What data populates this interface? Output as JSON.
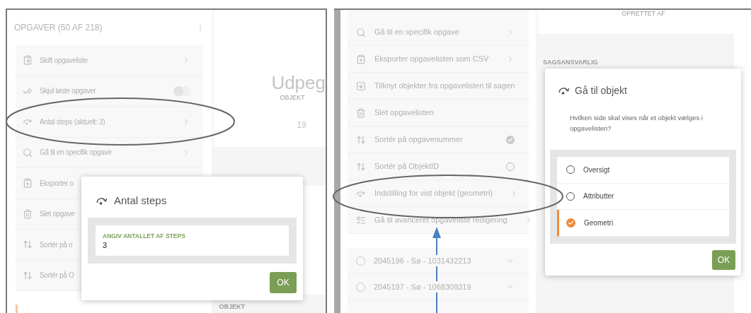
{
  "left": {
    "title": "OPGAVER (50 AF 218)",
    "menu": [
      {
        "kind": "nav",
        "label": "Skift opgaveliste"
      },
      {
        "kind": "toggle",
        "label": "Skjul løste opgaver",
        "on": false
      },
      {
        "kind": "nav",
        "label": "Antal steps (aktuelt: 3)"
      },
      {
        "kind": "nav",
        "label": "Gå til en specifik opgave"
      },
      {
        "kind": "plain",
        "label": "Eksporter o"
      },
      {
        "kind": "plain",
        "label": "Slet opgave"
      },
      {
        "kind": "plain",
        "label": "Sortér på o"
      },
      {
        "kind": "plain",
        "label": "Sortér på O"
      }
    ],
    "main": {
      "heading": "Udpeg",
      "subheading": "OBJEKT",
      "number": "19",
      "section": "OBJEKT"
    },
    "dialog": {
      "title": "Antal steps",
      "field_label": "ANGIV ANTALLET AF STEPS",
      "value": "3",
      "button": "OK"
    }
  },
  "right": {
    "menu": [
      {
        "kind": "nav",
        "label": "Gå til en specifik opgave"
      },
      {
        "kind": "nav",
        "label": "Eksporter opgavelisten som CSV"
      },
      {
        "kind": "plain",
        "label": "Tilknyt objekter fra opgavelisten til sagen"
      },
      {
        "kind": "plain",
        "label": "Slet opgavelisten"
      },
      {
        "kind": "sort",
        "label": "Sortér på opgavenummer",
        "selected": true
      },
      {
        "kind": "sort",
        "label": "Sortér på ObjektID",
        "selected": false
      },
      {
        "kind": "nav",
        "label": "Indstilling for vist objekt (geometri)"
      },
      {
        "kind": "nav",
        "label": "Gå til avanceret opgaveliste redigering"
      }
    ],
    "tasks": [
      {
        "label": "2045196 - Sø - 1031432213",
        "checked": false
      },
      {
        "label": "2045197 - Sø - 1068309319",
        "checked": false
      }
    ],
    "main": {
      "created_label": "OPRETTET AF",
      "owner_label": "SAGSANSVARLIG"
    },
    "dialog": {
      "title": "Gå til objekt",
      "question": "Hvilken side skal vises når et objekt vælges i opgavelisten?",
      "options": [
        {
          "label": "Oversigt",
          "selected": false
        },
        {
          "label": "Attributter",
          "selected": false
        },
        {
          "label": "Geometri",
          "selected": true
        }
      ],
      "button": "OK"
    }
  }
}
